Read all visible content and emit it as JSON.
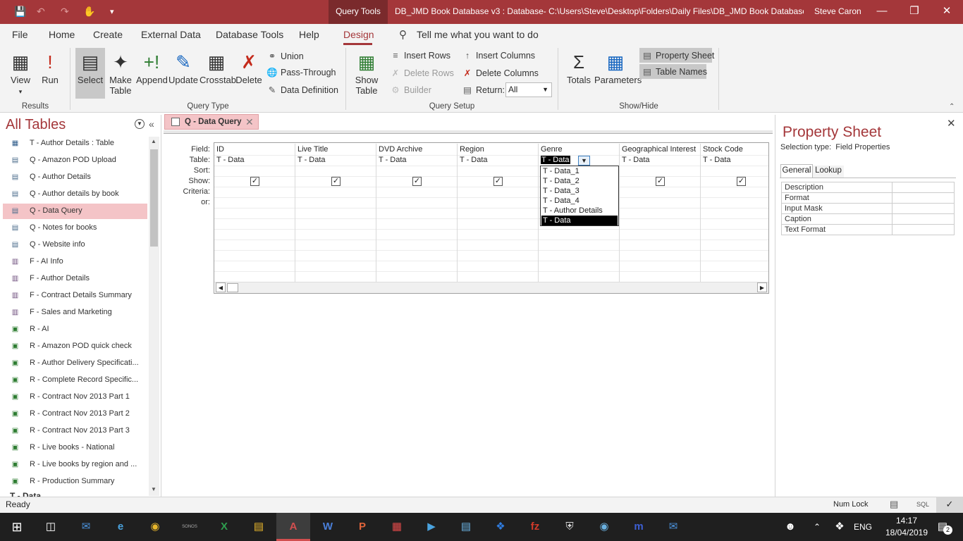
{
  "titlebar": {
    "context_tab": "Query Tools",
    "title": "DB_JMD Book Database v3 : Database- C:\\Users\\Steve\\Desktop\\Folders\\Daily Files\\DB_JMD Book Database v...",
    "user": "Steve Caron"
  },
  "menu": [
    "File",
    "Home",
    "Create",
    "External Data",
    "Database Tools",
    "Help",
    "Design"
  ],
  "tell_me": "Tell me what you want to do",
  "ribbon": {
    "results": {
      "view": "View",
      "run": "Run",
      "label": "Results"
    },
    "query_type": {
      "select": "Select",
      "make_table": "Make Table",
      "append": "Append",
      "update": "Update",
      "crosstab": "Crosstab",
      "delete": "Delete",
      "union": "Union",
      "pass_through": "Pass-Through",
      "data_definition": "Data Definition",
      "label": "Query Type"
    },
    "query_setup": {
      "show_table": "Show Table",
      "insert_rows": "Insert Rows",
      "delete_rows": "Delete Rows",
      "builder": "Builder",
      "insert_columns": "Insert Columns",
      "delete_columns": "Delete Columns",
      "return": "Return:",
      "return_value": "All",
      "label": "Query Setup"
    },
    "show_hide": {
      "totals": "Totals",
      "parameters": "Parameters",
      "property_sheet": "Property Sheet",
      "table_names": "Table Names",
      "label": "Show/Hide"
    }
  },
  "nav": {
    "title": "All Tables",
    "items": [
      {
        "label": "T - Author Details : Table",
        "kind": "table"
      },
      {
        "label": "Q - Amazon POD Upload",
        "kind": "query"
      },
      {
        "label": "Q - Author Details",
        "kind": "query"
      },
      {
        "label": "Q - Author details by book",
        "kind": "query"
      },
      {
        "label": "Q - Data Query",
        "kind": "query"
      },
      {
        "label": "Q - Notes for books",
        "kind": "query"
      },
      {
        "label": "Q - Website info",
        "kind": "query"
      },
      {
        "label": "F - AI Info",
        "kind": "form"
      },
      {
        "label": "F - Author Details",
        "kind": "form"
      },
      {
        "label": "F - Contract Details Summary",
        "kind": "form"
      },
      {
        "label": "F - Sales and Marketing",
        "kind": "form"
      },
      {
        "label": "R - AI",
        "kind": "report"
      },
      {
        "label": "R - Amazon POD quick check",
        "kind": "report"
      },
      {
        "label": "R - Author Delivery Specificati...",
        "kind": "report"
      },
      {
        "label": "R - Complete Record Specific...",
        "kind": "report"
      },
      {
        "label": "R - Contract Nov 2013 Part 1",
        "kind": "report"
      },
      {
        "label": "R - Contract Nov 2013 Part 2",
        "kind": "report"
      },
      {
        "label": "R - Contract Nov 2013 Part 3",
        "kind": "report"
      },
      {
        "label": "R - Live books - National",
        "kind": "report"
      },
      {
        "label": "R - Live books by region and ...",
        "kind": "report"
      },
      {
        "label": "R - Production Summary",
        "kind": "report"
      }
    ],
    "next_group": "T - Data"
  },
  "doc_tab": "Q - Data Query",
  "grid": {
    "row_labels": [
      "Field:",
      "Table:",
      "Sort:",
      "Show:",
      "Criteria:",
      "or:"
    ],
    "columns": [
      {
        "field": "ID",
        "table": "T - Data",
        "show": true
      },
      {
        "field": "Live Title",
        "table": "T - Data",
        "show": true
      },
      {
        "field": "DVD Archive",
        "table": "T - Data",
        "show": true
      },
      {
        "field": "Region",
        "table": "T - Data",
        "show": true
      },
      {
        "field": "Genre",
        "table": "T - Data",
        "show": false
      },
      {
        "field": "Geographical Interest",
        "table": "T - Data",
        "show": true
      },
      {
        "field": "Stock Code",
        "table": "T - Data",
        "show": true
      }
    ],
    "dropdown": [
      "T - Data_1",
      "T - Data_2",
      "T - Data_3",
      "T - Data_4",
      "T - Author Details",
      "T - Data"
    ]
  },
  "property_sheet": {
    "title": "Property Sheet",
    "selection_label": "Selection type:",
    "selection_value": "Field Properties",
    "tabs": [
      "General",
      "Lookup"
    ],
    "rows": [
      "Description",
      "Format",
      "Input Mask",
      "Caption",
      "Text Format"
    ]
  },
  "status": {
    "left": "Ready",
    "numlock": "Num Lock",
    "sql": "SQL"
  },
  "taskbar": {
    "lang": "ENG",
    "time": "14:17",
    "date": "18/04/2019",
    "notifications": "2",
    "sonos": "SONOS"
  },
  "colors": {
    "accent": "#a4373a",
    "selected": "#f4c4c7"
  }
}
